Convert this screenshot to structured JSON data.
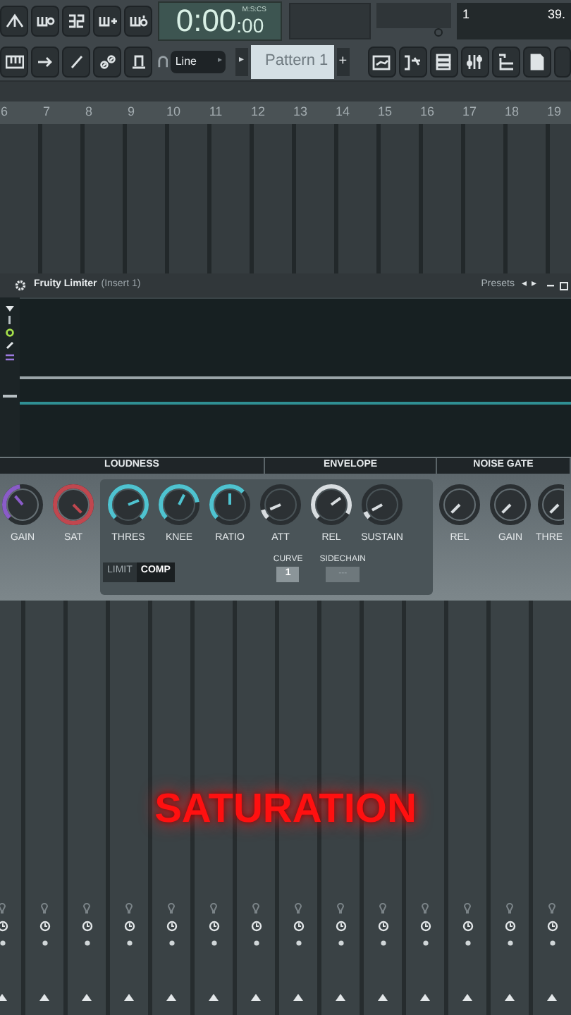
{
  "transport": {
    "time_main": "0:00",
    "time_cs": ":00",
    "time_format": "M:S:CS",
    "counter": "1",
    "tempo": "39."
  },
  "toolbar": {
    "snap": "Line",
    "snap_arrow": "▸",
    "pattern_play": "▸",
    "pattern": "Pattern 1",
    "pattern_add": "+"
  },
  "ruler": [
    "6",
    "7",
    "8",
    "9",
    "10",
    "11",
    "12",
    "13",
    "14",
    "15",
    "16",
    "17",
    "18",
    "19"
  ],
  "plugin": {
    "name": "Fruity Limiter",
    "slot": "(Insert 1)",
    "presets": "Presets",
    "prev": "◂",
    "next": "▸"
  },
  "sections": [
    {
      "label": "LOUDNESS"
    },
    {
      "label": "ENVELOPE"
    },
    {
      "label": "NOISE GATE"
    }
  ],
  "knobs_left": [
    {
      "label": "GAIN",
      "level": 0.35,
      "color": "#8a5cc8"
    },
    {
      "label": "SAT",
      "level": 1,
      "color": "#c0474f"
    }
  ],
  "knobs_comp": [
    {
      "label": "THRES",
      "level": 0.75,
      "color": "#4fc3d0"
    },
    {
      "label": "KNEE",
      "level": 0.6,
      "color": "#4fc3d0"
    },
    {
      "label": "RATIO",
      "level": 0.5,
      "color": "#4fc3d0"
    },
    {
      "label": "ATT",
      "level": 0.08,
      "color": "#d8dde0"
    },
    {
      "label": "REL",
      "level": 0.7,
      "color": "#d8dde0"
    },
    {
      "label": "SUSTAIN",
      "level": 0.06,
      "color": "#d8dde0"
    }
  ],
  "knobs_gate": [
    {
      "label": "REL"
    },
    {
      "label": "GAIN"
    },
    {
      "label": "THRE"
    }
  ],
  "mode_tabs": [
    {
      "label": "LIMIT",
      "selected": false
    },
    {
      "label": "COMP",
      "selected": true
    }
  ],
  "curve": {
    "label": "CURVE",
    "value": "1"
  },
  "sidechain": {
    "label": "SIDECHAIN",
    "value": "---"
  },
  "overlay_caption": "SATURATION"
}
